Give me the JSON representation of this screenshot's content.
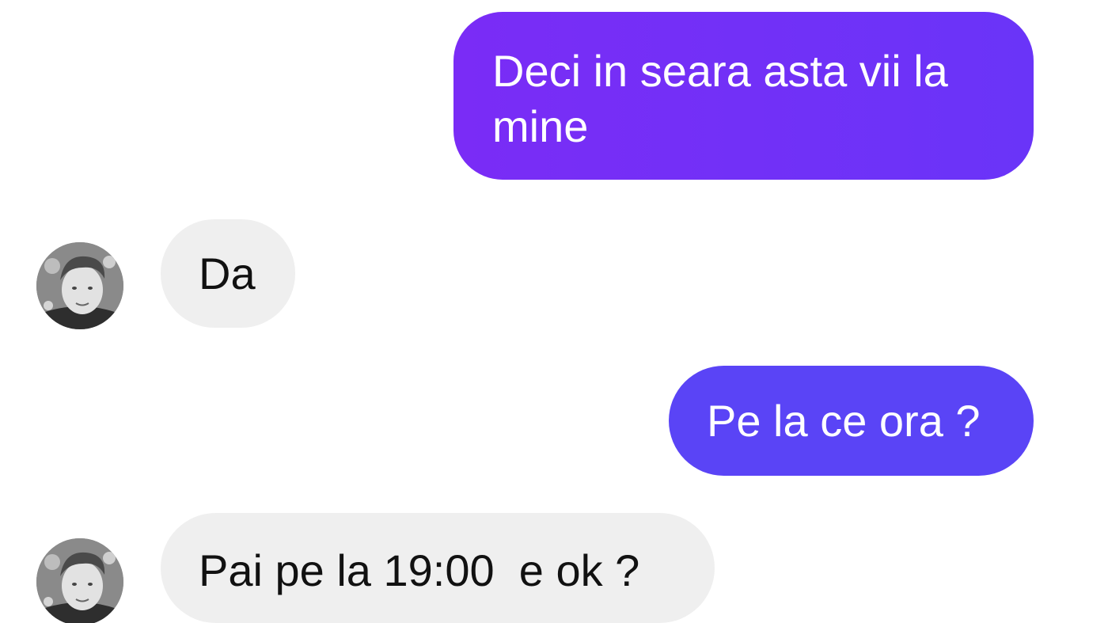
{
  "messages": [
    {
      "direction": "outgoing",
      "text": "Deci in seara asta vii la mine"
    },
    {
      "direction": "incoming",
      "text": "Da"
    },
    {
      "direction": "outgoing",
      "text": "Pe la ce ora ?"
    },
    {
      "direction": "incoming",
      "text": "Pai pe la 19:00  e ok ?"
    }
  ],
  "colors": {
    "outgoing_bubble_1": "#7a2cf6",
    "outgoing_bubble_2": "#5a44f6",
    "incoming_bubble": "#efefef",
    "background": "#ffffff"
  },
  "icons": {
    "contact_avatar": "contact-avatar-photo"
  }
}
